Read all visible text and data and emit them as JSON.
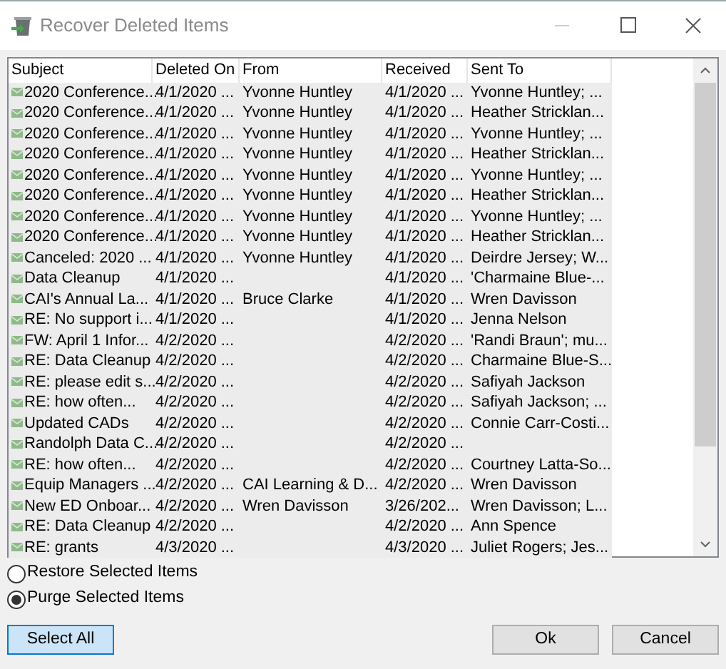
{
  "window": {
    "title": "Recover Deleted Items"
  },
  "table": {
    "columns": [
      "Subject",
      "Deleted On",
      "From",
      "Received",
      "Sent To"
    ],
    "rows": [
      {
        "cells": [
          "2020 Conference...",
          "4/1/2020 ...",
          "Yvonne Huntley",
          "4/1/2020 ...",
          "Yvonne Huntley; ..."
        ],
        "selected": true
      },
      {
        "cells": [
          "2020 Conference...",
          "4/1/2020 ...",
          "Yvonne Huntley",
          "4/1/2020 ...",
          "Heather Stricklan..."
        ],
        "selected": true
      },
      {
        "cells": [
          "2020 Conference...",
          "4/1/2020 ...",
          "Yvonne Huntley",
          "4/1/2020 ...",
          "Yvonne Huntley; ..."
        ],
        "selected": true
      },
      {
        "cells": [
          "2020 Conference...",
          "4/1/2020 ...",
          "Yvonne Huntley",
          "4/1/2020 ...",
          "Heather Stricklan..."
        ],
        "selected": true
      },
      {
        "cells": [
          "2020 Conference...",
          "4/1/2020 ...",
          "Yvonne Huntley",
          "4/1/2020 ...",
          "Yvonne Huntley; ..."
        ],
        "selected": true
      },
      {
        "cells": [
          "2020 Conference...",
          "4/1/2020 ...",
          "Yvonne Huntley",
          "4/1/2020 ...",
          "Heather Stricklan..."
        ],
        "selected": true
      },
      {
        "cells": [
          "2020 Conference...",
          "4/1/2020 ...",
          "Yvonne Huntley",
          "4/1/2020 ...",
          "Yvonne Huntley; ..."
        ],
        "selected": true
      },
      {
        "cells": [
          "2020 Conference...",
          "4/1/2020 ...",
          "Yvonne Huntley",
          "4/1/2020 ...",
          "Heather Stricklan..."
        ],
        "selected": true
      },
      {
        "cells": [
          "Canceled: 2020 ...",
          "4/1/2020 ...",
          "Yvonne Huntley",
          "4/1/2020 ...",
          "Deirdre Jersey; W..."
        ],
        "selected": true
      },
      {
        "cells": [
          "Data Cleanup",
          "4/1/2020 ...",
          "",
          "4/1/2020 ...",
          "'Charmaine Blue-..."
        ],
        "selected": true
      },
      {
        "cells": [
          "CAI's Annual La...",
          "4/1/2020 ...",
          "Bruce Clarke",
          "4/1/2020 ...",
          "Wren Davisson"
        ],
        "selected": true
      },
      {
        "cells": [
          "RE: No support i...",
          "4/1/2020 ...",
          "",
          "4/1/2020 ...",
          "Jenna Nelson"
        ],
        "selected": true
      },
      {
        "cells": [
          "FW: April 1 Infor...",
          "4/2/2020 ...",
          "",
          "4/2/2020 ...",
          "'Randi Braun'; mu..."
        ],
        "selected": true
      },
      {
        "cells": [
          "RE: Data Cleanup",
          "4/2/2020 ...",
          "",
          "4/2/2020 ...",
          "Charmaine Blue-S..."
        ],
        "selected": true
      },
      {
        "cells": [
          "RE: please edit s...",
          "4/2/2020 ...",
          "",
          "4/2/2020 ...",
          "Safiyah Jackson"
        ],
        "selected": true
      },
      {
        "cells": [
          "RE: how often...",
          "4/2/2020 ...",
          "",
          "4/2/2020 ...",
          "Safiyah Jackson; ..."
        ],
        "selected": true
      },
      {
        "cells": [
          "Updated CADs",
          "4/2/2020 ...",
          "",
          "4/2/2020 ...",
          "Connie Carr-Costi..."
        ],
        "selected": true
      },
      {
        "cells": [
          "Randolph Data C...",
          "4/2/2020 ...",
          "",
          "4/2/2020 ...",
          ""
        ],
        "selected": true
      },
      {
        "cells": [
          "RE: how often...",
          "4/2/2020 ...",
          "",
          "4/2/2020 ...",
          "Courtney Latta-So..."
        ],
        "selected": true
      },
      {
        "cells": [
          "Equip Managers ...",
          "4/2/2020 ...",
          "CAI Learning & D...",
          "4/2/2020 ...",
          "Wren Davisson"
        ],
        "selected": true
      },
      {
        "cells": [
          "New ED Onboar...",
          "4/2/2020 ...",
          "Wren Davisson",
          "3/26/202...",
          "Wren Davisson; L..."
        ],
        "selected": true
      },
      {
        "cells": [
          "RE: Data Cleanup",
          "4/2/2020 ...",
          "",
          "4/2/2020 ...",
          "Ann Spence"
        ],
        "selected": true
      },
      {
        "cells": [
          "RE: grants",
          "4/3/2020 ...",
          "",
          "4/3/2020 ...",
          "Juliet Rogers; Jes..."
        ],
        "selected": true
      }
    ]
  },
  "options": [
    {
      "label": "Restore Selected Items",
      "selected": false
    },
    {
      "label": "Purge Selected Items",
      "selected": true
    }
  ],
  "buttons": [
    {
      "label": "Select All",
      "kind": "focused"
    },
    {
      "label": "Ok",
      "kind": "normal"
    },
    {
      "label": "Cancel",
      "kind": "normal"
    }
  ]
}
